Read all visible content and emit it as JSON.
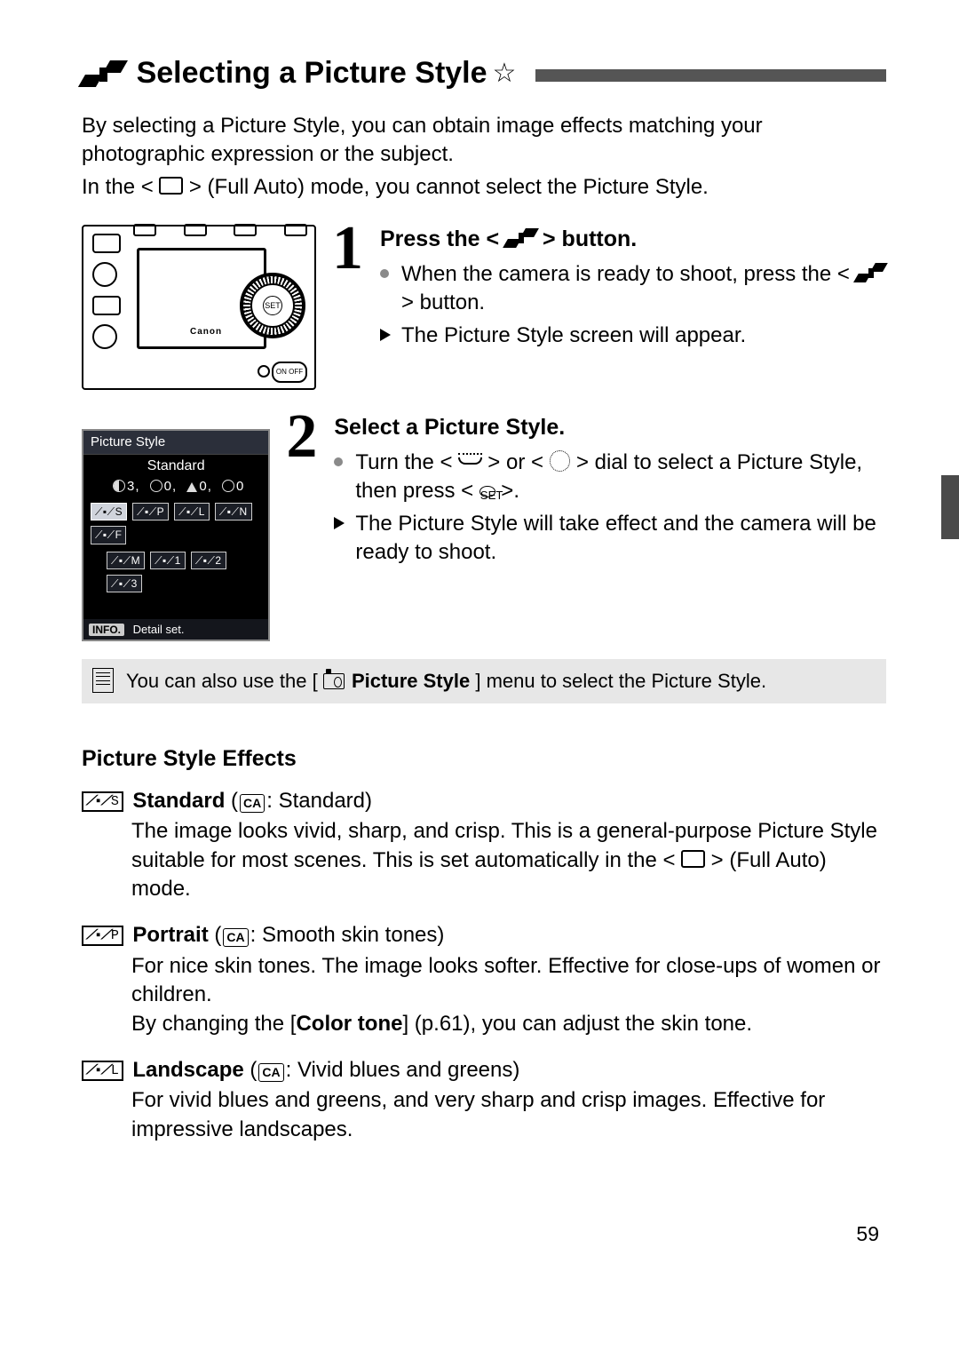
{
  "title": "Selecting a Picture Style",
  "intro": {
    "p1": "By selecting a Picture Style, you can obtain image effects matching your photographic expression or the subject.",
    "p2_a": "In the <",
    "p2_b": "> (Full Auto) mode, you cannot select the Picture Style."
  },
  "step1": {
    "head_a": "Press the <",
    "head_b": "> button.",
    "b1_a": "When the camera is ready to shoot, press the <",
    "b1_b": "> button.",
    "b2": "The Picture Style screen will appear."
  },
  "step2": {
    "head": "Select a Picture Style.",
    "b1_a": "Turn the <",
    "b1_b": "> or <",
    "b1_c": "> dial to select a Picture Style, then press <",
    "b1_d": ">.",
    "b2": "The Picture Style will take effect and the camera will be ready to shoot."
  },
  "camera_brand": "Canon",
  "camera_set": "SET",
  "camera_onoff": "ON OFF",
  "lcd": {
    "title": "Picture Style",
    "style": "Standard",
    "params": "3,      0,      0,      0",
    "p_vals": {
      "sharp": "3",
      "contrast": "0",
      "sat": "0",
      "tone": "0"
    },
    "chips_row1": [
      "S",
      "P",
      "L",
      "N",
      "F"
    ],
    "chips_row2": [
      "M",
      "1",
      "2",
      "3"
    ],
    "footer_badge": "INFO.",
    "footer_text": "Detail set."
  },
  "note": {
    "a": "You can also use the [",
    "b": " Picture Style",
    "c": "] menu to select the Picture Style."
  },
  "effects_head": "Picture Style Effects",
  "effects": {
    "standard": {
      "chip": "S",
      "name": "Standard",
      "ca": "Standard",
      "desc_a": "The image looks vivid, sharp, and crisp. This is a general-purpose Picture Style suitable for most scenes. This is set automatically in the <",
      "desc_b": "> (Full Auto) mode."
    },
    "portrait": {
      "chip": "P",
      "name": "Portrait",
      "ca": "Smooth skin tones",
      "desc1": "For nice skin tones. The image looks softer. Effective for close-ups of women or children.",
      "desc2_a": "By changing the [",
      "desc2_bold": "Color tone",
      "desc2_b": "] (p.61), you can adjust the skin tone."
    },
    "landscape": {
      "chip": "L",
      "name": "Landscape",
      "ca": "Vivid blues and greens",
      "desc": "For vivid blues and greens, and very sharp and crisp images. Effective for impressive landscapes."
    }
  },
  "set_label": "SET",
  "page_number": "59"
}
